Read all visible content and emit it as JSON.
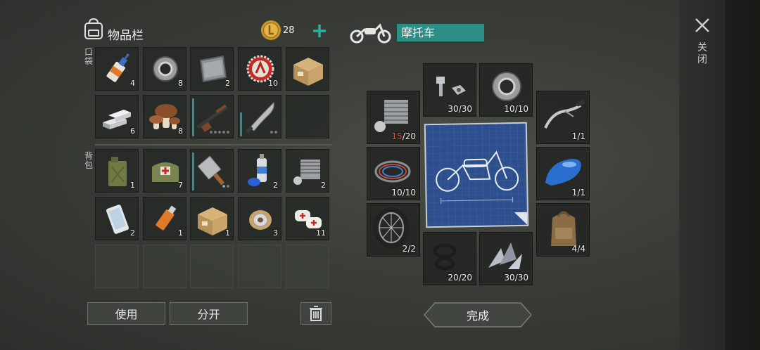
{
  "inventory": {
    "title": "物品栏",
    "coins": "28",
    "pocket_label": "口袋",
    "backpack_label": "背包",
    "pocket_items": [
      {
        "name": "glue",
        "count": "4"
      },
      {
        "name": "bearing",
        "count": "8"
      },
      {
        "name": "metal-plate",
        "count": "2"
      },
      {
        "name": "bottle-cap",
        "count": "10"
      },
      {
        "name": "cardboard-box",
        "count": ""
      },
      {
        "name": "silver-bars",
        "count": "6"
      },
      {
        "name": "mushrooms",
        "count": "8"
      },
      {
        "name": "assault-rifle",
        "count": ""
      },
      {
        "name": "machete",
        "count": ""
      },
      {
        "name": "empty",
        "count": ""
      }
    ],
    "backpack_items": [
      {
        "name": "jerrycan",
        "count": "1"
      },
      {
        "name": "medical-bag",
        "count": "7"
      },
      {
        "name": "cleaver",
        "count": ""
      },
      {
        "name": "spray-paint",
        "count": "2"
      },
      {
        "name": "engine-cylinder",
        "count": "2"
      },
      {
        "name": "smartphone",
        "count": "2"
      },
      {
        "name": "usb-drive",
        "count": "1"
      },
      {
        "name": "cardboard-box",
        "count": "1"
      },
      {
        "name": "wire-spool",
        "count": "3"
      },
      {
        "name": "bandages",
        "count": "11"
      }
    ],
    "use_label": "使用",
    "split_label": "分开"
  },
  "craft": {
    "title": "摩托车",
    "slots": [
      {
        "name": "engine-cylinder",
        "have": "15",
        "need": "/20"
      },
      {
        "name": "bolt-nut",
        "have": "30",
        "need": "/30"
      },
      {
        "name": "bearing",
        "have": "10",
        "need": "/10"
      },
      {
        "name": "handlebar",
        "have": "1",
        "need": "/1"
      },
      {
        "name": "wires",
        "have": "10",
        "need": "/10"
      },
      {
        "name": "fuel-tank",
        "have": "1",
        "need": "/1"
      },
      {
        "name": "wheel",
        "have": "2",
        "need": "/2"
      },
      {
        "name": "rubber-seals",
        "have": "20",
        "need": "/20"
      },
      {
        "name": "metal-shards",
        "have": "30",
        "need": "/30"
      },
      {
        "name": "backpack",
        "have": "4",
        "need": "/4"
      }
    ],
    "complete_label": "完成"
  },
  "close_label": "关闭",
  "colors": {
    "accent": "#2b9a8e",
    "red": "#e0473e",
    "blueprint": "#2d4f8e"
  }
}
